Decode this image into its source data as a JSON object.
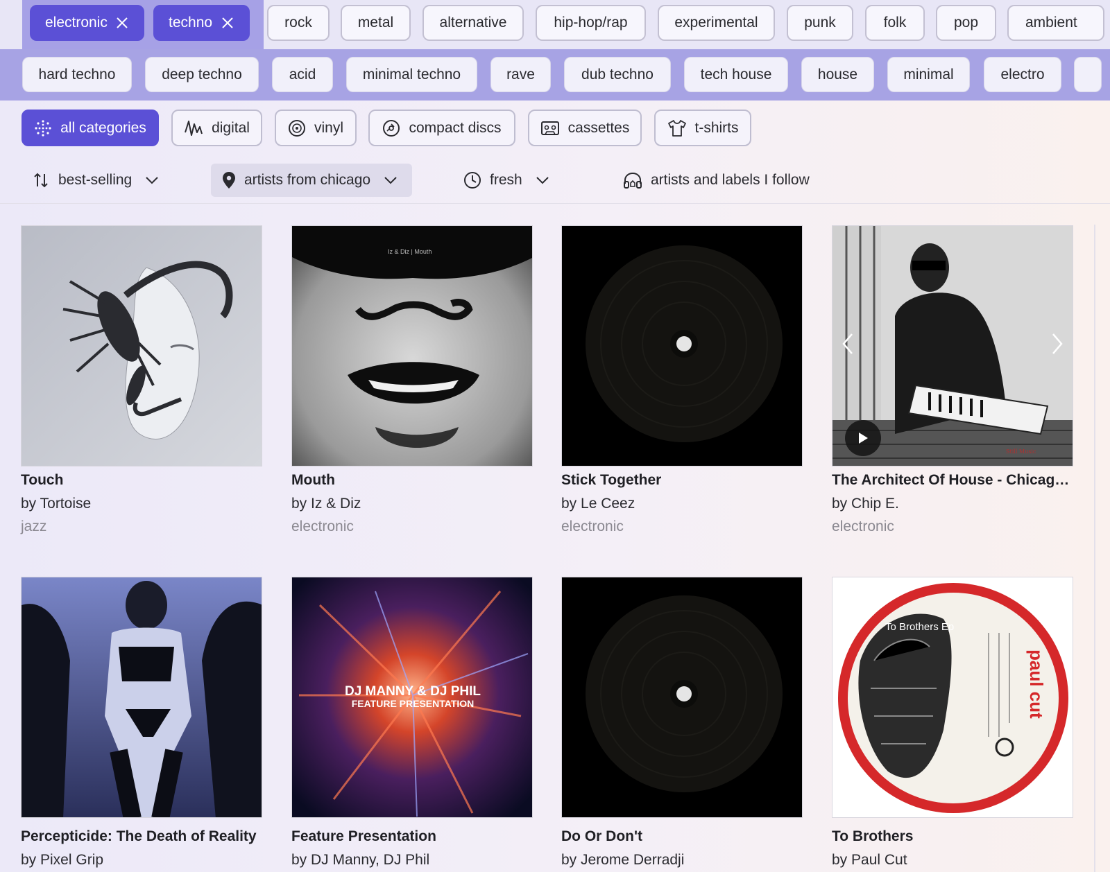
{
  "selected_tags": [
    {
      "label": "electronic"
    },
    {
      "label": "techno"
    }
  ],
  "genres": [
    "rock",
    "metal",
    "alternative",
    "hip-hop/rap",
    "experimental",
    "punk",
    "folk",
    "pop",
    "ambient"
  ],
  "subgenres": [
    "hard techno",
    "deep techno",
    "acid",
    "minimal techno",
    "rave",
    "dub techno",
    "tech house",
    "house",
    "minimal",
    "electro"
  ],
  "formats": [
    {
      "label": "all categories",
      "icon": "sparkle-icon",
      "active": true
    },
    {
      "label": "digital",
      "icon": "waveform-icon"
    },
    {
      "label": "vinyl",
      "icon": "vinyl-icon"
    },
    {
      "label": "compact discs",
      "icon": "cd-icon"
    },
    {
      "label": "cassettes",
      "icon": "cassette-icon"
    },
    {
      "label": "t-shirts",
      "icon": "tshirt-icon"
    }
  ],
  "filters": {
    "sort": "best-selling",
    "location": "artists from chicago",
    "time": "fresh",
    "follow": "artists and labels I follow"
  },
  "albums": [
    {
      "title": "Touch",
      "artist": "by Tortoise",
      "genre": "jazz"
    },
    {
      "title": "Mouth",
      "artist": "by Iz & Diz",
      "genre": "electronic",
      "cover_text": "Iz & Diz | Mouth"
    },
    {
      "title": "Stick Together",
      "artist": "by Le Ceez",
      "genre": "electronic"
    },
    {
      "title": "The Architect Of House - Chicago…",
      "artist": "by Chip E.",
      "genre": "electronic"
    },
    {
      "title": "Percepticide: The Death of Reality",
      "artist": "by Pixel Grip",
      "genre": ""
    },
    {
      "title": "Feature Presentation",
      "artist": "by DJ Manny, DJ Phil",
      "genre": "",
      "cover_text_1": "DJ MANNY & DJ PHIL",
      "cover_text_2": "FEATURE PRESENTATION"
    },
    {
      "title": "Do Or Don't",
      "artist": "by Jerome Derradji",
      "genre": ""
    },
    {
      "title": "To Brothers",
      "artist": "by Paul Cut",
      "genre": "",
      "cover_text_1": "To Brothers Ep",
      "cover_text_2": "paul cut"
    }
  ],
  "colors": {
    "accent": "#5b50d6",
    "tag_band": "#a7a3e4"
  }
}
